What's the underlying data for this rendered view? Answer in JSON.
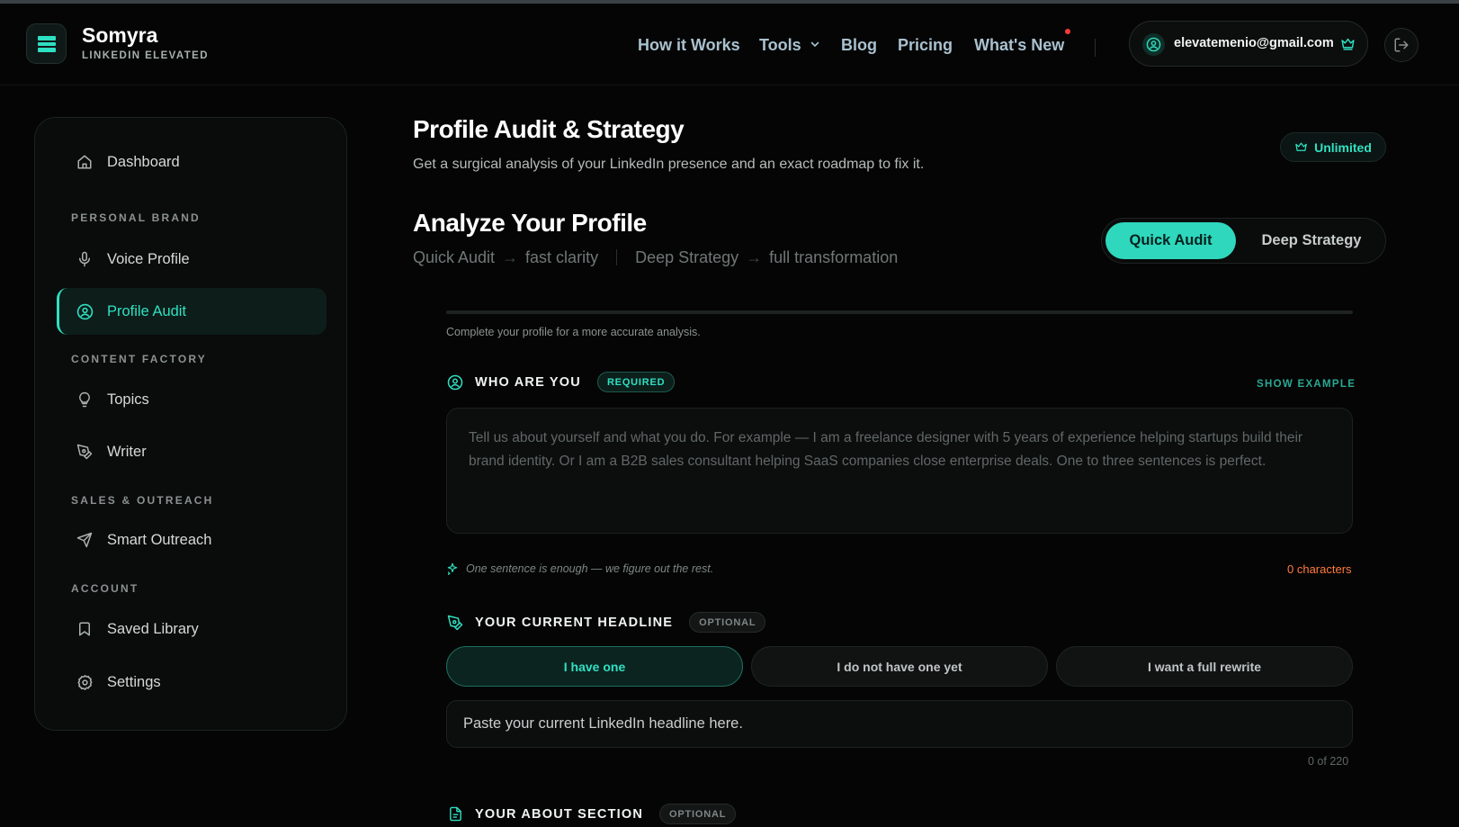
{
  "brand": {
    "name": "Somyra",
    "tagline": "LINKEDIN ELEVATED"
  },
  "nav": {
    "how_it_works": "How it Works",
    "tools": "Tools",
    "blog": "Blog",
    "pricing": "Pricing",
    "whats_new": "What's New"
  },
  "user": {
    "email": "elevatemenio@gmail.com"
  },
  "sidebar": {
    "dashboard": "Dashboard",
    "section_personal": "PERSONAL BRAND",
    "voice_profile": "Voice Profile",
    "profile_audit": "Profile Audit",
    "section_content": "CONTENT FACTORY",
    "topics": "Topics",
    "writer": "Writer",
    "section_sales": "SALES & OUTREACH",
    "smart_outreach": "Smart Outreach",
    "section_account": "ACCOUNT",
    "saved_library": "Saved Library",
    "settings": "Settings"
  },
  "page": {
    "title": "Profile Audit & Strategy",
    "subtitle": "Get a surgical analysis of your LinkedIn presence and an exact roadmap to fix it.",
    "plan_badge": "Unlimited"
  },
  "analyze": {
    "title": "Analyze Your Profile",
    "quick_label": "Quick Audit",
    "quick_desc": "fast clarity",
    "deep_label": "Deep Strategy",
    "deep_desc": "full transformation",
    "arrow": "→",
    "toggle_quick": "Quick Audit",
    "toggle_deep": "Deep Strategy"
  },
  "progress": {
    "hint": "Complete your profile for a more accurate analysis.",
    "fraction": 0
  },
  "who": {
    "label": "WHO ARE YOU",
    "badge": "REQUIRED",
    "show_example": "SHOW EXAMPLE",
    "placeholder": "Tell us about yourself and what you do. For example — I am a freelance designer with 5 years of experience helping startups build their brand identity. Or I am a B2B sales consultant helping SaaS companies close enterprise deals. One to three sentences is perfect.",
    "hint": "One sentence is enough — we figure out the rest.",
    "char_count": "0 characters"
  },
  "headline": {
    "label": "YOUR CURRENT HEADLINE",
    "badge": "OPTIONAL",
    "opt_have": "I have one",
    "opt_none": "I do not have one yet",
    "opt_rewrite": "I want a full rewrite",
    "input_value": "Paste your current LinkedIn headline here.",
    "limit": "0 of 220"
  },
  "about": {
    "label": "YOUR ABOUT SECTION",
    "badge": "OPTIONAL"
  },
  "colors": {
    "accent": "#2fe0c2",
    "background": "#050505",
    "warning": "#ff7a3d"
  },
  "icons": [
    "logo-icon",
    "chevron-down-icon",
    "user-circle-icon",
    "crown-icon",
    "logout-icon",
    "home-icon",
    "mic-icon",
    "user-circle-icon",
    "lightbulb-icon",
    "pen-nib-icon",
    "send-icon",
    "bookmark-icon",
    "gear-icon",
    "sparkle-icon",
    "document-icon"
  ]
}
